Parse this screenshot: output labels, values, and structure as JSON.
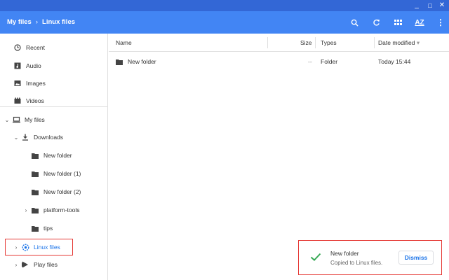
{
  "window": {
    "min": "_",
    "max": "□",
    "close": "✕"
  },
  "breadcrumb": {
    "root": "My files",
    "sep": "›",
    "current": "Linux files"
  },
  "toolbar": {
    "search": "search-icon",
    "refresh": "refresh-icon",
    "grid": "grid-view-icon",
    "sort": "AZ",
    "more": "⋮"
  },
  "sidebar": {
    "recent": "Recent",
    "audio": "Audio",
    "images": "Images",
    "videos": "Videos",
    "my_files": "My files",
    "downloads": "Downloads",
    "new_folder": "New folder",
    "new_folder_1": "New folder (1)",
    "new_folder_2": "New folder (2)",
    "platform_tools": "platform-tools",
    "tips": "tips",
    "linux_files": "Linux files",
    "play_files": "Play files"
  },
  "columns": {
    "name": "Name",
    "size": "Size",
    "types": "Types",
    "date": "Date modified",
    "sort_arrow": "▾"
  },
  "files": [
    {
      "name": "New folder",
      "size": "--",
      "type": "Folder",
      "date": "Today 15:44"
    }
  ],
  "toast": {
    "title": "New folder",
    "message": "Copied to Linux files.",
    "button": "Dismiss"
  },
  "colors": {
    "titlebar": "#3367d6",
    "header": "#4285f4",
    "accent": "#1a73e8",
    "highlight": "#e53935",
    "check": "#34a853"
  }
}
